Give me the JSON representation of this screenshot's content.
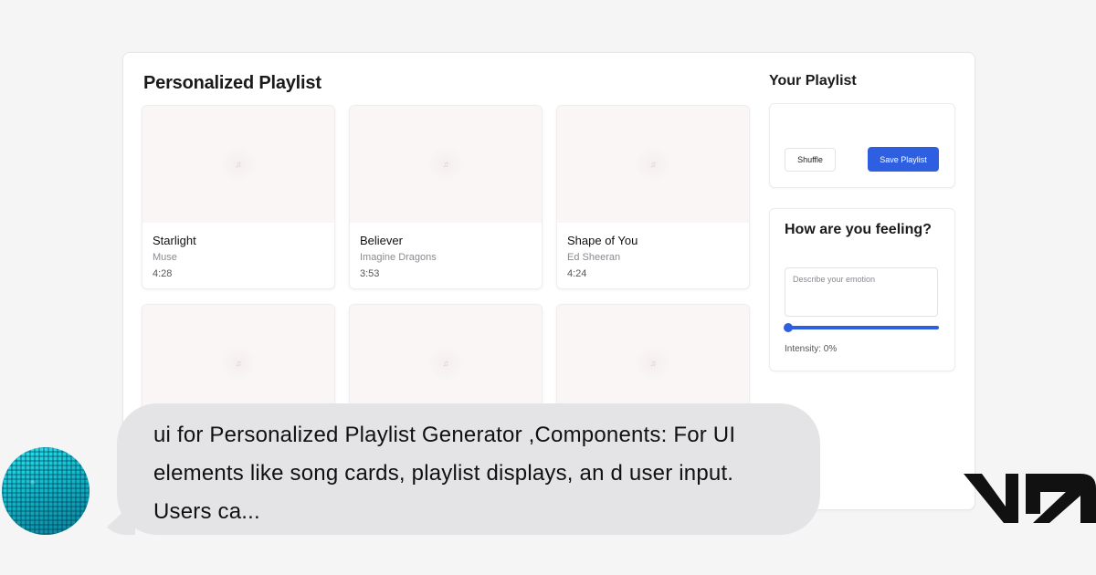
{
  "page": {
    "title": "Personalized Playlist"
  },
  "songs": [
    {
      "title": "Starlight",
      "artist": "Muse",
      "duration": "4:28"
    },
    {
      "title": "Believer",
      "artist": "Imagine Dragons",
      "duration": "3:53"
    },
    {
      "title": "Shape of You",
      "artist": "Ed Sheeran",
      "duration": "4:24"
    },
    {
      "title": "",
      "artist": "",
      "duration": ""
    },
    {
      "title": "",
      "artist": "",
      "duration": ""
    },
    {
      "title": "",
      "artist": "",
      "duration": ""
    }
  ],
  "sidebar": {
    "playlist_title": "Your Playlist",
    "shuffle_label": "Shuffle",
    "save_label": "Save Playlist",
    "mood_title": "How are you feeling?",
    "emotion_placeholder": "Describe your emotion",
    "intensity_label": "Intensity: 0%",
    "intensity_value": 0
  },
  "chat": {
    "message": "ui for Personalized Playlist Generator ,Components: For UI elements like song cards, playlist displays, an d user input. Users ca..."
  },
  "colors": {
    "accent": "#2d5fe0",
    "art_placeholder": "#faf6f6",
    "chat_bubble": "#e4e4e6",
    "avatar": "#12b9cc"
  },
  "icons": {
    "song_art": "music-note-icon",
    "brand": "v0-logo"
  }
}
